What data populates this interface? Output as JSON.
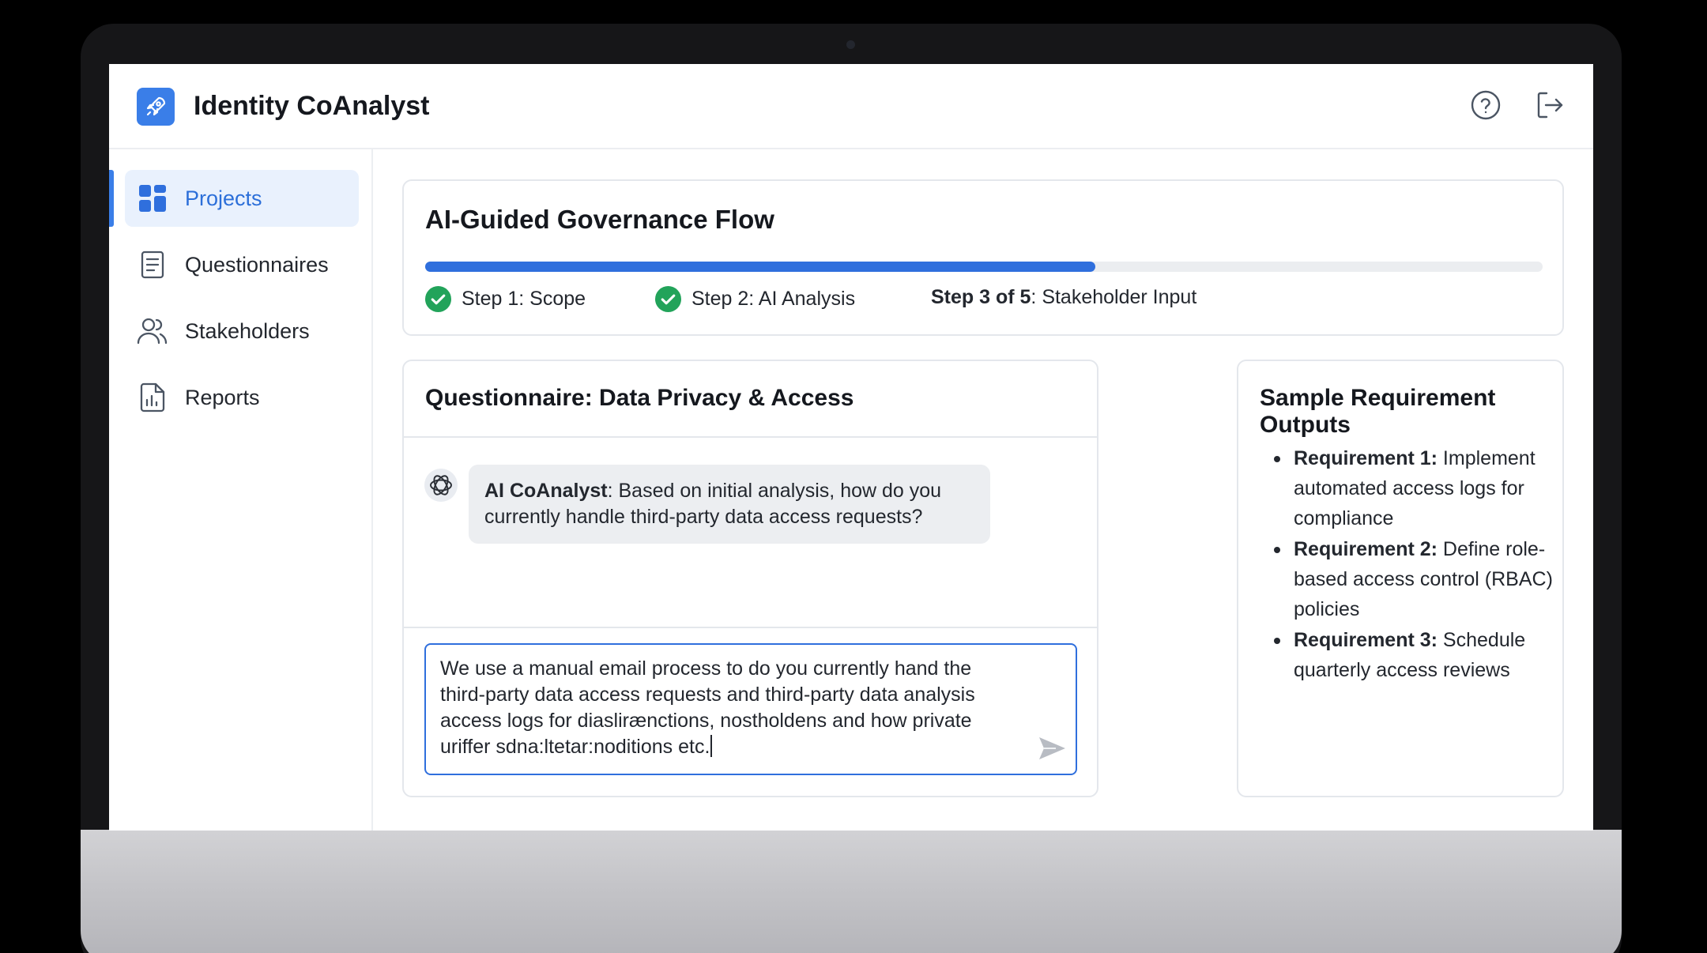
{
  "app": {
    "title": "Identity CoAnalyst",
    "accent": "#3a7ee8",
    "icons": {
      "logo": "rocket-icon",
      "help": "help-circle-icon",
      "logout": "logout-icon"
    }
  },
  "sidebar": {
    "items": [
      {
        "label": "Projects",
        "icon": "grid-icon",
        "active": true
      },
      {
        "label": "Questionnaires",
        "icon": "document-icon",
        "active": false
      },
      {
        "label": "Stakeholders",
        "icon": "users-icon",
        "active": false
      },
      {
        "label": "Reports",
        "icon": "report-icon",
        "active": false
      }
    ]
  },
  "flow": {
    "title": "AI-Guided Governance Flow",
    "progress_percent": 60,
    "steps": [
      {
        "label": "Step 1: Scope",
        "done": true
      },
      {
        "label": "Step 2: AI Analysis",
        "done": true
      },
      {
        "prefix": "Step 3 of 5",
        "suffix": ": Stakeholder Input",
        "current": true
      }
    ]
  },
  "questionnaire": {
    "title": "Questionnaire: Data Privacy & Access",
    "ai_name": "AI CoAnalyst",
    "ai_message": ": Based on initial analysis, how do you currently handle third-party data access requests?",
    "answer_lines": [
      "We use a manual email process to do you currently hand the",
      "third-party data access requests and third-party data analysis",
      "access logs for diaslirænctions, nostholdens and how private",
      "uriffer sdna:ltetar:noditions etc."
    ]
  },
  "requirements": {
    "title": "Sample Requirement Outputs",
    "items": [
      {
        "label": "Requirement 1:",
        "text": " Implement automated access logs for compliance"
      },
      {
        "label": "Requirement 2:",
        "text": " Define role-based access control (RBAC) policies"
      },
      {
        "label": "Requirement 3:",
        "text": " Schedule quarterly access reviews"
      }
    ]
  }
}
